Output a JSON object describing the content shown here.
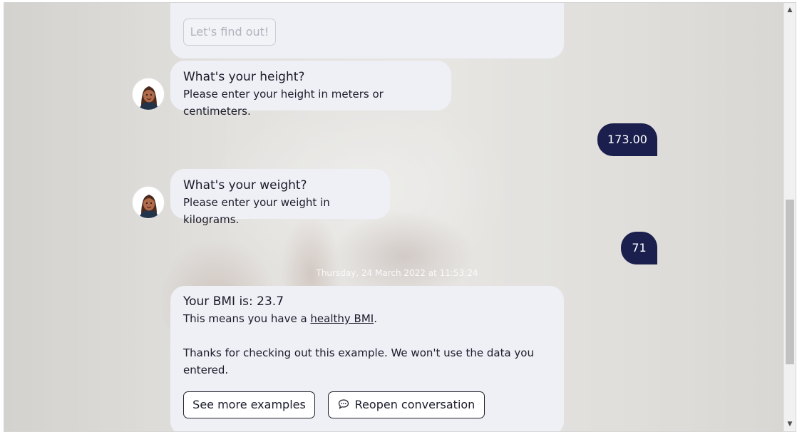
{
  "conversation": {
    "partial_bubble": {
      "button_label": "Let's find out!"
    },
    "height_question": {
      "title": "What's your height?",
      "text": "Please enter your height in meters or centimeters."
    },
    "height_answer": "173.00",
    "weight_question": {
      "title": "What's your weight?",
      "text": "Please enter your weight in kilograms."
    },
    "weight_answer": "71",
    "timestamp": "Thursday, 24 March 2022 at 11:53:24",
    "result": {
      "title": "Your BMI is: 23.7",
      "line_prefix": "This means you have a ",
      "line_link": "healthy BMI",
      "line_suffix": ".",
      "thanks": "Thanks for checking out this example. We won't use the data you entered.",
      "see_more_label": "See more examples",
      "reopen_label": "Reopen conversation"
    }
  },
  "colors": {
    "user_bubble": "#1a1f4d",
    "bot_bubble": "#eef0f5"
  },
  "icons": {
    "avatar": "woman-avatar-icon",
    "reopen": "chat-bubble-icon"
  }
}
